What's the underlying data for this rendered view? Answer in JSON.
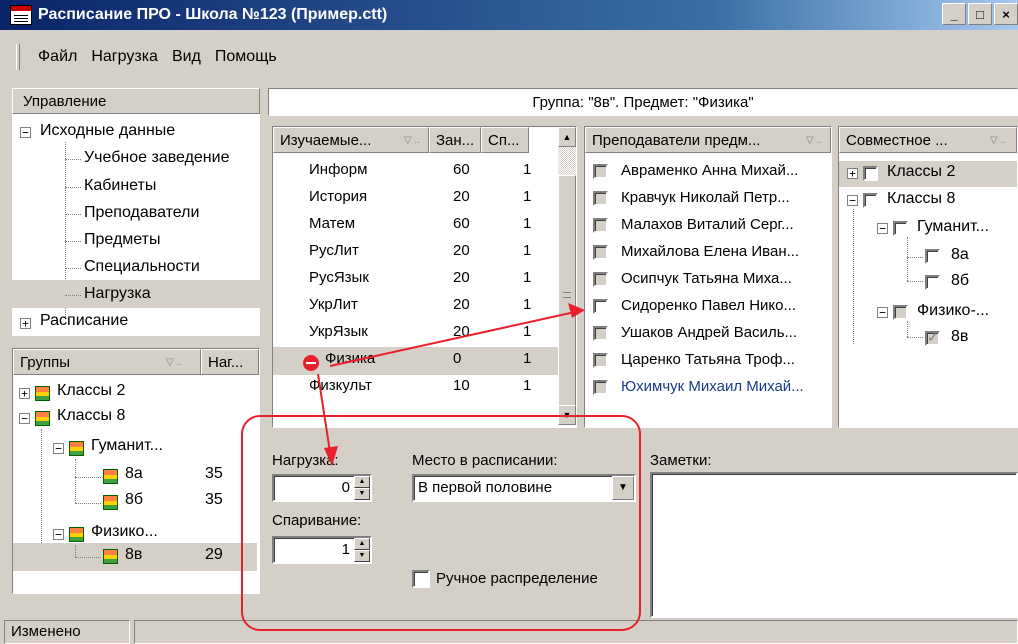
{
  "window": {
    "title": "Расписание ПРО - Школа №123 (Пример.ctt)",
    "min": "_",
    "max": "□",
    "close": "×"
  },
  "menu": [
    "Файл",
    "Нагрузка",
    "Вид",
    "Помощь"
  ],
  "control": {
    "header": "Управление",
    "tree": {
      "source": "Исходные данные",
      "children": [
        "Учебное заведение",
        "Кабинеты",
        "Преподаватели",
        "Предметы",
        "Специальности",
        "Нагрузка"
      ],
      "schedule": "Расписание"
    }
  },
  "groups": {
    "col1": "Группы",
    "col2": "Наг...",
    "items": [
      {
        "label": "Классы 2",
        "value": ""
      },
      {
        "label": "Классы 8",
        "value": ""
      },
      {
        "label": "Гуманит...",
        "value": ""
      },
      {
        "label": "8а",
        "value": "35"
      },
      {
        "label": "8б",
        "value": "35"
      },
      {
        "label": "Физико...",
        "value": ""
      },
      {
        "label": "8в",
        "value": "29"
      }
    ]
  },
  "main_header": "Группа: \"8в\". Предмет: \"Физика\"",
  "subjects": {
    "cols": [
      "Изучаемые...",
      "Зан...",
      "Сп..."
    ],
    "rows": [
      {
        "name": "Информ",
        "zan": "60",
        "sp": "1"
      },
      {
        "name": "История",
        "zan": "20",
        "sp": "1"
      },
      {
        "name": "Матем",
        "zan": "60",
        "sp": "1"
      },
      {
        "name": "РусЛит",
        "zan": "20",
        "sp": "1"
      },
      {
        "name": "РусЯзык",
        "zan": "20",
        "sp": "1"
      },
      {
        "name": "УкрЛит",
        "zan": "20",
        "sp": "1"
      },
      {
        "name": "УкрЯзык",
        "zan": "20",
        "sp": "1"
      },
      {
        "name": "Физика",
        "zan": "0",
        "sp": "1"
      },
      {
        "name": "Физкульт",
        "zan": "10",
        "sp": "1"
      }
    ]
  },
  "teachers": {
    "header": "Преподаватели предм...",
    "items": [
      "Авраменко Анна Михай...",
      "Кравчук Николай Петр...",
      "Малахов Виталий Серг...",
      "Михайлова Елена Иван...",
      "Осипчук Татьяна Миха...",
      "Сидоренко Павел Нико...",
      "Ушаков Андрей Василь...",
      "Царенко Татьяна Троф...",
      "Юхимчук Михаил Михай..."
    ]
  },
  "joint": {
    "header": "Совместное ...",
    "items": [
      "Классы 2",
      "Классы 8",
      "Гуманит...",
      "8а",
      "8б",
      "Физико-...",
      "8в"
    ]
  },
  "form": {
    "load_label": "Нагрузка:",
    "load_value": "0",
    "pairing_label": "Спаривание:",
    "pairing_value": "1",
    "place_label": "Место в расписании:",
    "place_value": "В первой половине",
    "manual_label": "Ручное распределение",
    "notes_label": "Заметки:"
  },
  "status": {
    "text": "Изменено"
  },
  "colors": {
    "accent": "#e8202a",
    "selected_row": "#d4d0c8",
    "title_bar": "#0a246a",
    "link_teacher": "#1a3a8a"
  }
}
